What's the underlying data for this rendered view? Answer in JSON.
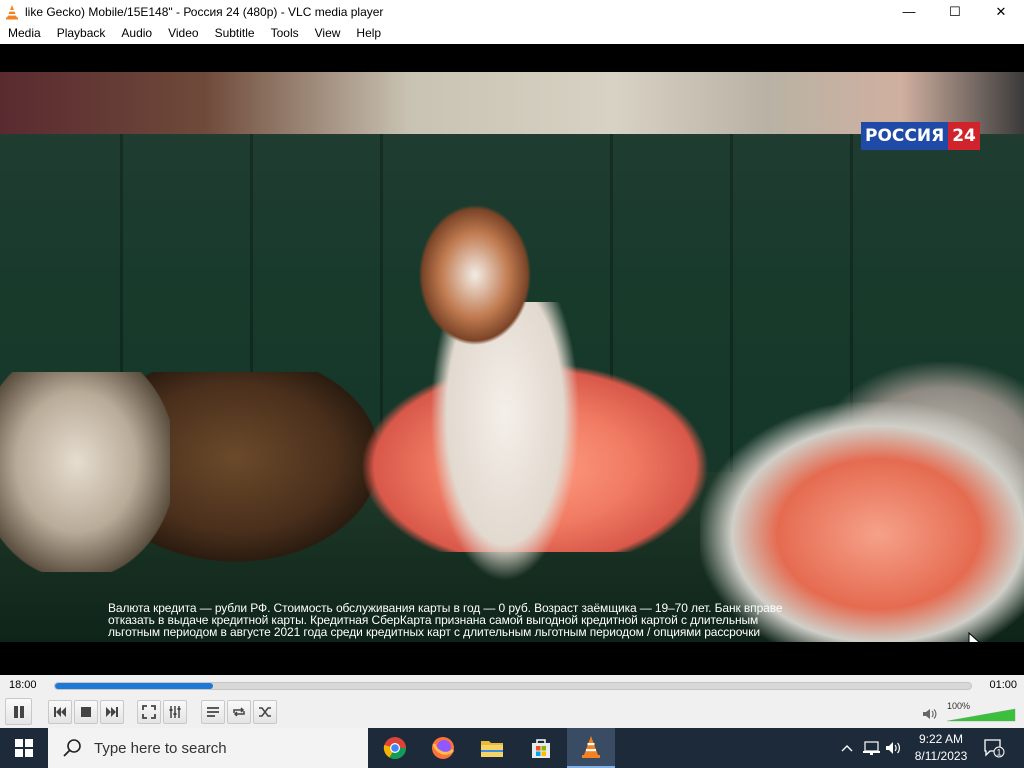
{
  "window": {
    "title": "like Gecko) Mobile/15E148\" - Россия 24 (480p) - VLC media player",
    "controls": {
      "minimize": "—",
      "maximize": "☐",
      "close": "✕"
    }
  },
  "menu": [
    {
      "label": "Media"
    },
    {
      "label": "Playback"
    },
    {
      "label": "Audio"
    },
    {
      "label": "Video"
    },
    {
      "label": "Subtitle"
    },
    {
      "label": "Tools"
    },
    {
      "label": "View"
    },
    {
      "label": "Help"
    }
  ],
  "video": {
    "channel_logo": {
      "main": "РОССИЯ",
      "num": "24"
    },
    "disclaimer_lines": [
      "Валюта кредита — рубли РФ. Стоимость обслуживания карты в год — 0 руб. Возраст заёмщика — 19–70 лет. Банк вправе",
      "отказать в выдаче кредитной карты. Кредитная СберКарта признана самой выгодной кредитной картой с длительным",
      "льготным периодом в августе 2021 года среди кредитных карт с длительным льготным периодом / опциями рассрочки"
    ],
    "colors": {
      "logo_blue": "#1f4aa8",
      "logo_red": "#d0232c"
    }
  },
  "player": {
    "elapsed": "18:00",
    "remaining": "01:00",
    "progress_fraction": 0.173,
    "volume_label": "100%",
    "volume_fraction": 1.0,
    "accent_color": "#1e78d6",
    "buttons": [
      {
        "name": "pause-button",
        "icon": "pause-icon"
      },
      {
        "name": "previous-button",
        "icon": "previous-icon"
      },
      {
        "name": "stop-button",
        "icon": "stop-icon"
      },
      {
        "name": "next-button",
        "icon": "next-icon"
      },
      {
        "name": "fullscreen-button",
        "icon": "fullscreen-icon"
      },
      {
        "name": "extended-settings-button",
        "icon": "equalizer-icon"
      },
      {
        "name": "playlist-button",
        "icon": "playlist-icon"
      },
      {
        "name": "loop-button",
        "icon": "loop-icon"
      },
      {
        "name": "shuffle-button",
        "icon": "shuffle-icon"
      }
    ]
  },
  "taskbar": {
    "search_placeholder": "Type here to search",
    "apps": [
      {
        "name": "chrome",
        "icon": "chrome-icon"
      },
      {
        "name": "firefox",
        "icon": "firefox-icon"
      },
      {
        "name": "file-explorer",
        "icon": "folder-icon"
      },
      {
        "name": "microsoft-store",
        "icon": "store-icon"
      },
      {
        "name": "vlc",
        "icon": "vlc-icon",
        "active": true
      }
    ],
    "time": "9:22 AM",
    "date": "8/11/2023",
    "notification_count": "1"
  }
}
